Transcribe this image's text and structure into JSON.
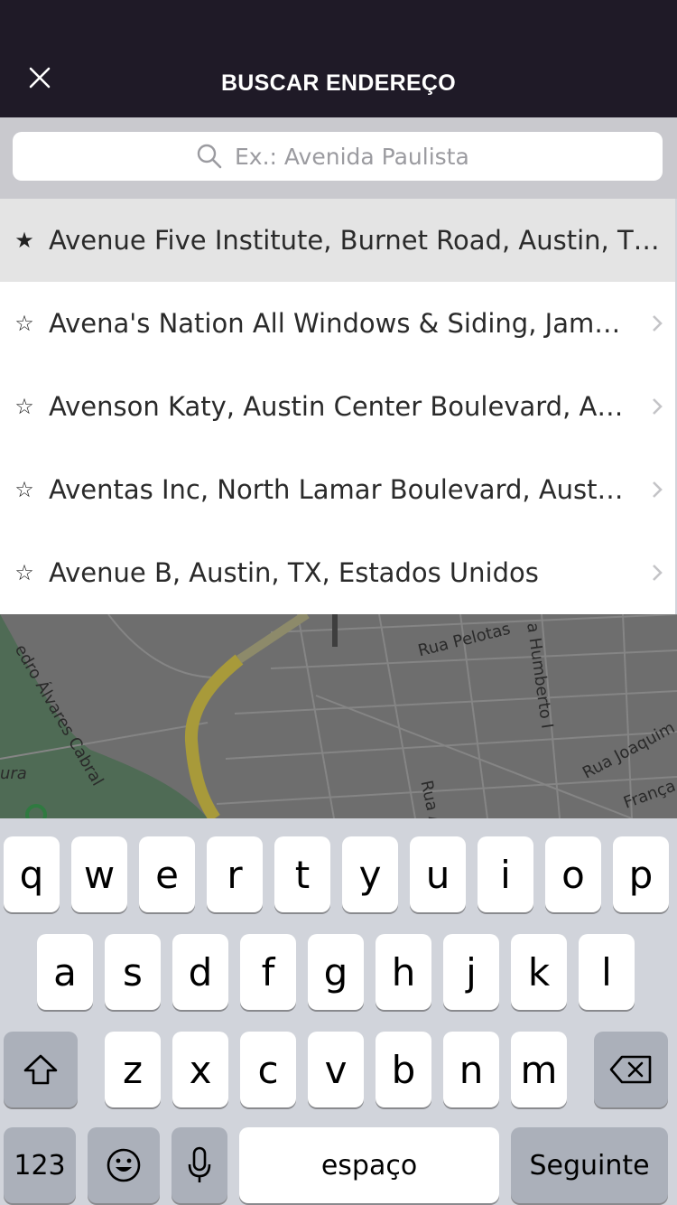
{
  "header": {
    "title": "BUSCAR ENDEREÇO"
  },
  "search": {
    "placeholder": "Ex.: Avenida Paulista"
  },
  "results": [
    {
      "label": "Avenue Five Institute, Burnet Road, Austin, TX, Estados Unidos",
      "starred": true,
      "selected": true
    },
    {
      "label": "Avena's Nation All Windows & Siding, James Avenue, Austin, TX",
      "starred": false
    },
    {
      "label": "Avenson Katy, Austin Center Boulevard, Austin, TX",
      "starred": false
    },
    {
      "label": "Aventas Inc, North Lamar Boulevard, Austin, TX",
      "starred": false
    },
    {
      "label": "Avenue B, Austin, TX, Estados Unidos",
      "starred": false
    }
  ],
  "map": {
    "labels": {
      "pedro": "edro Álvares Cabral",
      "pelotas": "Rua Pelotas",
      "humberto": "a Humberto I",
      "joaquim": "Rua Joaquim",
      "franca": "França",
      "ura": "ura",
      "rua": "Rua A"
    }
  },
  "keyboard": {
    "row1": [
      "q",
      "w",
      "e",
      "r",
      "t",
      "y",
      "u",
      "i",
      "o",
      "p"
    ],
    "row2": [
      "a",
      "s",
      "d",
      "f",
      "g",
      "h",
      "j",
      "k",
      "l"
    ],
    "row3": [
      "z",
      "x",
      "c",
      "v",
      "b",
      "n",
      "m"
    ],
    "numbers_label": "123",
    "space_label": "espaço",
    "next_label": "Seguinte"
  }
}
